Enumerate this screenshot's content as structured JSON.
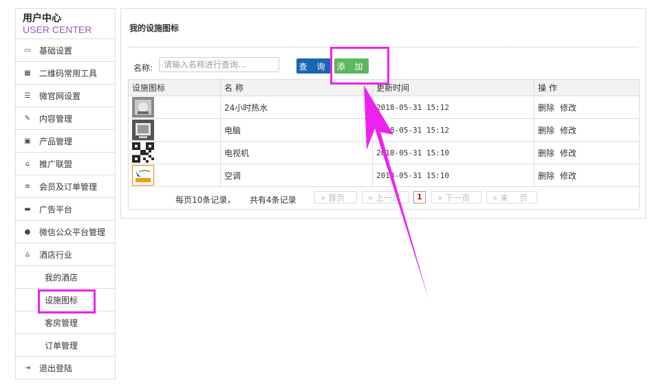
{
  "sidebar": {
    "title": "用户中心",
    "subtitle": "USER CENTER",
    "items": [
      {
        "label": "基础设置",
        "icon": "monitor-icon",
        "glyph": "▭"
      },
      {
        "label": "二维码常用工具",
        "icon": "qrcode-icon",
        "glyph": "▦"
      },
      {
        "label": "微官网设置",
        "icon": "menu-icon",
        "glyph": "☰"
      },
      {
        "label": "内容管理",
        "icon": "edit-icon",
        "glyph": "✎"
      },
      {
        "label": "产品管理",
        "icon": "picture-icon",
        "glyph": "▣"
      },
      {
        "label": "推广联盟",
        "icon": "gift-icon",
        "glyph": "⌂"
      },
      {
        "label": "会员及订单管理",
        "icon": "database-icon",
        "glyph": "≡"
      },
      {
        "label": "广告平台",
        "icon": "coffee-icon",
        "glyph": "▬"
      },
      {
        "label": "微信公众平台管理",
        "icon": "chat-icon",
        "glyph": "●"
      },
      {
        "label": "酒店行业",
        "icon": "home-icon",
        "glyph": "⌂"
      }
    ],
    "sub_items": [
      "我的酒店",
      "设施图标",
      "客房管理",
      "订单管理"
    ],
    "logout": {
      "label": "退出登陆",
      "icon": "logout-icon",
      "glyph": "⇥"
    }
  },
  "main": {
    "title": "我的设施图标",
    "search_label": "名称:",
    "search_placeholder": "请输入名称进行查询...",
    "search_value": "",
    "query_button": "查 询",
    "add_button": "添 加",
    "columns": [
      "设施图标",
      "名 称",
      "更新时间",
      "操 作"
    ],
    "rows": [
      {
        "name": "24小时热水",
        "time": "2018-05-31 15:12",
        "delete": "删除",
        "edit": "修改",
        "thumb": "photo"
      },
      {
        "name": "电脑",
        "time": "2018-05-31 15:12",
        "delete": "删除",
        "edit": "修改",
        "thumb": "photo-dark"
      },
      {
        "name": "电视机",
        "time": "2018-05-31 15:10",
        "delete": "删除",
        "edit": "修改",
        "thumb": "qrcode"
      },
      {
        "name": "空调",
        "time": "2018-05-31 15:10",
        "delete": "删除",
        "edit": "修改",
        "thumb": "logo"
      }
    ],
    "pager": {
      "per_page": "每页10条记录，",
      "total": "共有4条记录",
      "first": "» 首页",
      "prev": "» 上一页",
      "current": "1",
      "next": "» 下一页",
      "last": "» 末　 页"
    }
  },
  "colors": {
    "highlight": "#ee22ee",
    "query_button": "#1a66b5",
    "add_button": "#5cb85c",
    "subtitle": "#9b59b6"
  }
}
